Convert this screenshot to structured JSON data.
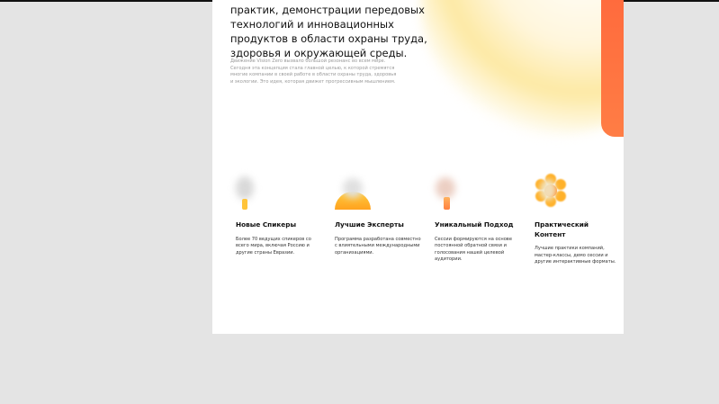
{
  "hero": {
    "title": "практик, демонстрации передовых технологий и инновационных продуктов в области охраны труда, здоровья и окружающей среды.",
    "description": "Движение Vision Zero вызвало большой резонанс во всем мире. Сегодня эта концепция стала главной целью, к которой стремятся многие компании в своей работе в области охраны труда, здоровья и экологии. Это идея, которая движет прогрессивным мышлением."
  },
  "features": [
    {
      "icon": "speaker-icon",
      "title": "Новые Спикеры",
      "description": "Более 70 ведущих спикеров со всего мира, включая Россию и другие страны Евразии."
    },
    {
      "icon": "experts-icon",
      "title": "Лучшие Эксперты",
      "description": "Программа разработана совместно с влиятельными международными организациями."
    },
    {
      "icon": "approach-icon",
      "title": "Уникальный Подход",
      "description": "Сессии формируются на основе постоянной обратной связи и голосования нашей целевой аудитории."
    },
    {
      "icon": "content-icon",
      "title": "Практический Контент",
      "description": "Лучшие практики компаний, мастер-классы, демо сессии и другие интерактивные форматы."
    }
  ],
  "colors": {
    "accent": "#ff6b3d",
    "yellow": "#ffc43a",
    "orange": "#ff8a1e",
    "background": "#e4e4e4",
    "card": "#ffffff"
  }
}
